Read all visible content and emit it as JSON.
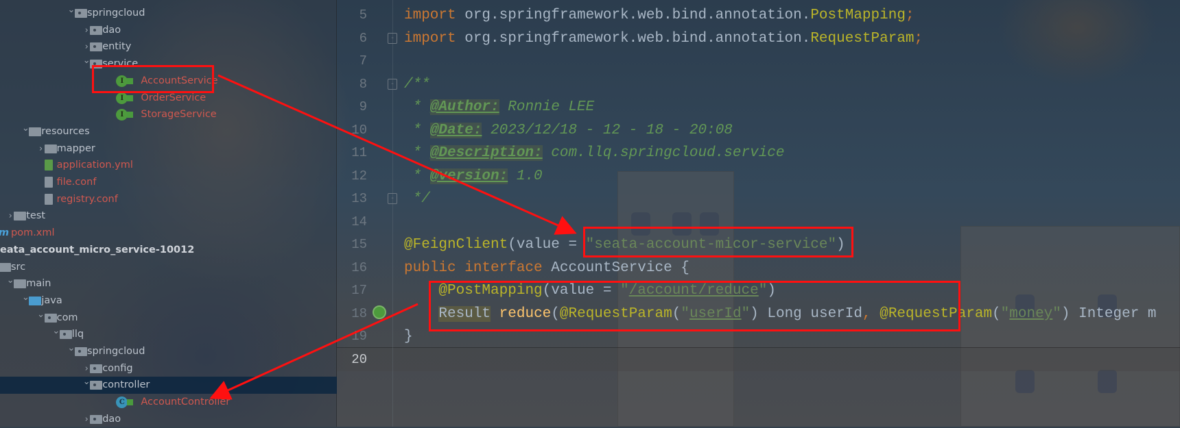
{
  "project_tree": [
    {
      "label": "springcloud",
      "kind": "package",
      "indent": 5,
      "expanded": true
    },
    {
      "label": "dao",
      "kind": "package",
      "indent": 6,
      "expanded": false
    },
    {
      "label": "entity",
      "kind": "package",
      "indent": 6,
      "expanded": false
    },
    {
      "label": "service",
      "kind": "package",
      "indent": 6,
      "expanded": true
    },
    {
      "label": "AccountService",
      "kind": "interface",
      "indent": 7,
      "modified": true
    },
    {
      "label": "OrderService",
      "kind": "interface",
      "indent": 7,
      "modified": true
    },
    {
      "label": "StorageService",
      "kind": "interface",
      "indent": 7,
      "modified": true
    },
    {
      "label": "resources",
      "kind": "resources",
      "indent": 2,
      "expanded": true
    },
    {
      "label": "mapper",
      "kind": "folder",
      "indent": 3,
      "expanded": false
    },
    {
      "label": "application.yml",
      "kind": "yml",
      "indent": 3,
      "modified": true
    },
    {
      "label": "file.conf",
      "kind": "file",
      "indent": 3,
      "modified": true
    },
    {
      "label": "registry.conf",
      "kind": "file",
      "indent": 3,
      "modified": true
    },
    {
      "label": "test",
      "kind": "folder",
      "indent": 1,
      "expanded": false
    },
    {
      "label": "pom.xml",
      "kind": "maven",
      "indent": 0,
      "modified": true
    },
    {
      "label": "eata_account_micro_service-10012",
      "kind": "module",
      "indent": -1
    },
    {
      "label": "src",
      "kind": "folder",
      "indent": 0,
      "expanded": true
    },
    {
      "label": "main",
      "kind": "folder",
      "indent": 1,
      "expanded": true
    },
    {
      "label": "java",
      "kind": "java",
      "indent": 2,
      "expanded": true
    },
    {
      "label": "com",
      "kind": "package",
      "indent": 3,
      "expanded": true
    },
    {
      "label": "llq",
      "kind": "package",
      "indent": 4,
      "expanded": true
    },
    {
      "label": "springcloud",
      "kind": "package",
      "indent": 5,
      "expanded": true
    },
    {
      "label": "config",
      "kind": "package",
      "indent": 6,
      "expanded": false
    },
    {
      "label": "controller",
      "kind": "package",
      "indent": 6,
      "expanded": true,
      "selected": true
    },
    {
      "label": "AccountController",
      "kind": "class",
      "indent": 7,
      "modified": true
    },
    {
      "label": "dao",
      "kind": "package",
      "indent": 6,
      "expanded": false
    }
  ],
  "icons": {
    "interface": "I",
    "class": "C",
    "maven": "m"
  },
  "editor": {
    "current_line": 20,
    "lines": [
      {
        "n": "5",
        "tokens": [
          {
            "t": "import ",
            "k": "kw"
          },
          {
            "t": "org.springframework.web.bind.annotation.",
            "k": "pl"
          },
          {
            "t": "PostMapping",
            "k": "an"
          },
          {
            "t": ";",
            "k": "kw"
          }
        ]
      },
      {
        "n": "6",
        "tokens": [
          {
            "t": "import ",
            "k": "kw"
          },
          {
            "t": "org.springframework.web.bind.annotation.",
            "k": "pl"
          },
          {
            "t": "RequestParam",
            "k": "an"
          },
          {
            "t": ";",
            "k": "kw"
          }
        ]
      },
      {
        "n": "7",
        "tokens": []
      },
      {
        "n": "8",
        "tokens": [
          {
            "t": "/**",
            "k": "cm"
          }
        ]
      },
      {
        "n": "9",
        "tokens": [
          {
            "t": " * ",
            "k": "cm"
          },
          {
            "t": "@Author:",
            "k": "tag"
          },
          {
            "t": " Ronnie LEE",
            "k": "cm"
          }
        ]
      },
      {
        "n": "10",
        "tokens": [
          {
            "t": " * ",
            "k": "cm"
          },
          {
            "t": "@Date:",
            "k": "tag"
          },
          {
            "t": " 2023/12/18 - 12 - 18 - 20:08",
            "k": "cm"
          }
        ]
      },
      {
        "n": "11",
        "tokens": [
          {
            "t": " * ",
            "k": "cm"
          },
          {
            "t": "@Description:",
            "k": "tag"
          },
          {
            "t": " com.llq.springcloud.service",
            "k": "cm"
          }
        ]
      },
      {
        "n": "12",
        "tokens": [
          {
            "t": " * ",
            "k": "cm"
          },
          {
            "t": "@version:",
            "k": "tag"
          },
          {
            "t": " 1.0",
            "k": "cm"
          }
        ]
      },
      {
        "n": "13",
        "tokens": [
          {
            "t": " */",
            "k": "cm"
          }
        ]
      },
      {
        "n": "14",
        "tokens": []
      },
      {
        "n": "15",
        "tokens": [
          {
            "t": "@FeignClient",
            "k": "an"
          },
          {
            "t": "(value = ",
            "k": "pl"
          },
          {
            "t": "\"seata-account-micor-service\"",
            "k": "str"
          },
          {
            "t": ")",
            "k": "pl"
          }
        ]
      },
      {
        "n": "16",
        "tokens": [
          {
            "t": "public interface ",
            "k": "kw"
          },
          {
            "t": "AccountService {",
            "k": "pl"
          }
        ]
      },
      {
        "n": "17",
        "tokens": [
          {
            "t": "    ",
            "k": "pl"
          },
          {
            "t": "@PostMapping",
            "k": "an"
          },
          {
            "t": "(value = ",
            "k": "pl"
          },
          {
            "t": "\"",
            "k": "str"
          },
          {
            "t": "/account/reduce",
            "k": "url"
          },
          {
            "t": "\"",
            "k": "str"
          },
          {
            "t": ")",
            "k": "pl"
          }
        ]
      },
      {
        "n": "18",
        "tokens": [
          {
            "t": "    ",
            "k": "pl"
          },
          {
            "t": "Result",
            "k": "hl"
          },
          {
            "t": " ",
            "k": "pl"
          },
          {
            "t": "reduce",
            "k": "fn"
          },
          {
            "t": "(",
            "k": "pl"
          },
          {
            "t": "@RequestParam",
            "k": "an"
          },
          {
            "t": "(",
            "k": "pl"
          },
          {
            "t": "\"",
            "k": "str"
          },
          {
            "t": "userId",
            "k": "url"
          },
          {
            "t": "\"",
            "k": "str"
          },
          {
            "t": ") Long userId",
            "k": "pl"
          },
          {
            "t": ", ",
            "k": "kw"
          },
          {
            "t": "@RequestParam",
            "k": "an"
          },
          {
            "t": "(",
            "k": "pl"
          },
          {
            "t": "\"",
            "k": "str"
          },
          {
            "t": "money",
            "k": "url"
          },
          {
            "t": "\"",
            "k": "str"
          },
          {
            "t": ") Integer m",
            "k": "pl"
          }
        ]
      },
      {
        "n": "19",
        "tokens": [
          {
            "t": "}",
            "k": "pl"
          }
        ]
      },
      {
        "n": "20",
        "tokens": []
      }
    ]
  },
  "annotation_color": "#ff1010"
}
